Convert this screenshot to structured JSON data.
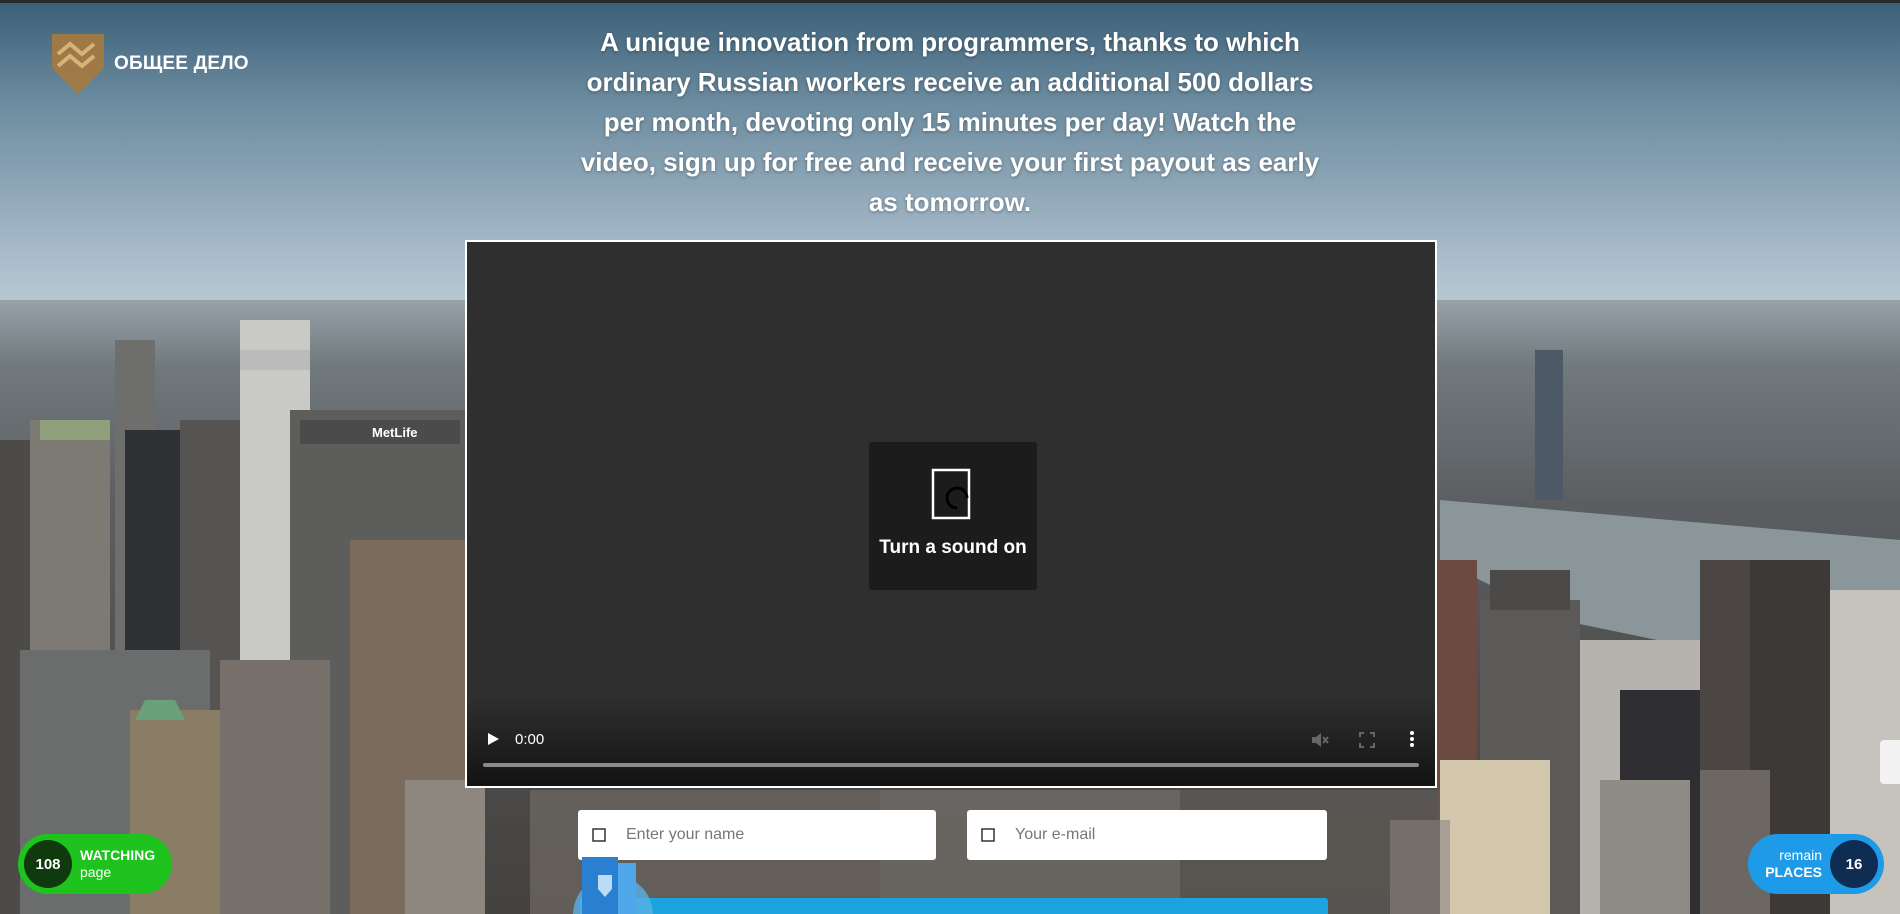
{
  "brand": {
    "name": "ОБЩЕЕ ДЕЛО",
    "logo_icon": "handshake-shield-icon"
  },
  "headline": "A unique innovation from programmers, thanks to which ordinary Russian workers receive an additional 500 dollars per month, devoting only 15 minutes per day! Watch the video, sign up for free and receive your first payout as early as tomorrow.",
  "video": {
    "overlay_label": "Turn a sound on",
    "overlay_icon": "speaker-icon",
    "time": "0:00",
    "progress": 0,
    "controls": [
      "play-icon",
      "mute-icon",
      "fullscreen-icon",
      "more-options-icon"
    ]
  },
  "form": {
    "name_placeholder": "Enter your name",
    "email_placeholder": "Your e-mail",
    "name_icon": "user-icon",
    "email_icon": "mail-icon"
  },
  "badges": {
    "watching": {
      "count": "108",
      "label": "WATCHING",
      "sub": "page"
    },
    "places": {
      "count": "16",
      "label": "PLACES",
      "sub": "remain"
    }
  },
  "colors": {
    "video_bg": "#2f2f2f",
    "watching_badge": "#1ec31e",
    "places_badge": "#1e9be8",
    "cta": "#1aa3dc"
  }
}
